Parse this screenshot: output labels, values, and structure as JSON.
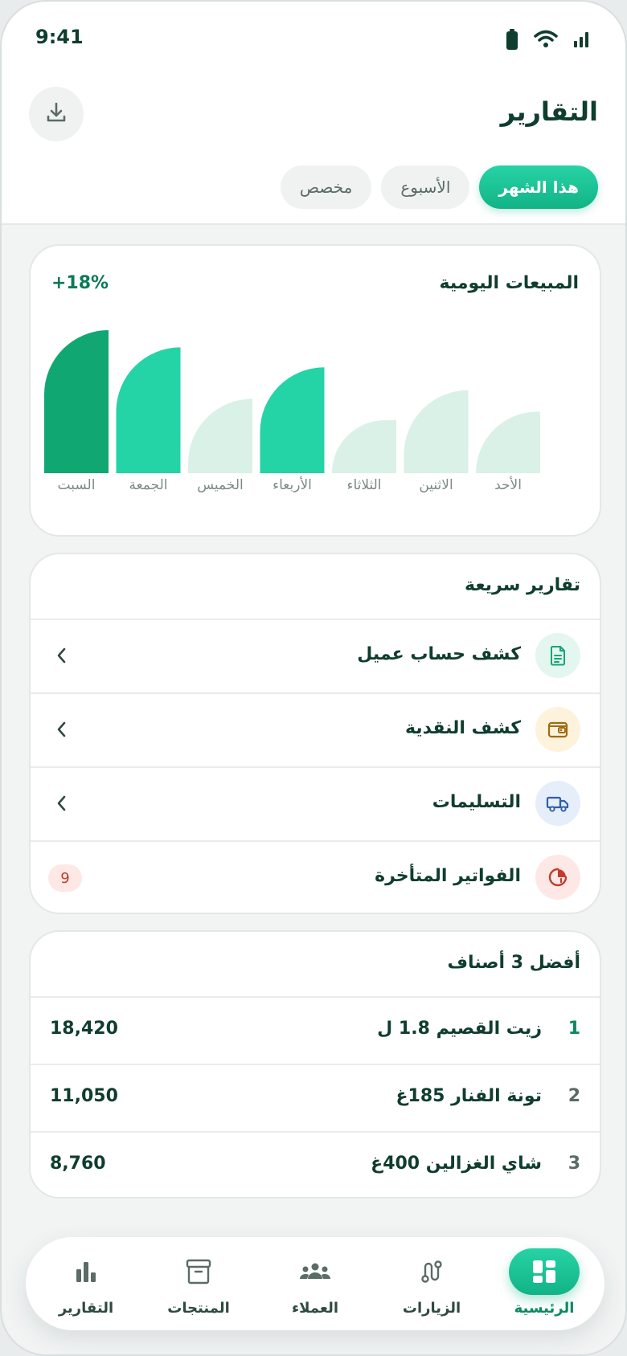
{
  "status_bar": {
    "time": "9:41"
  },
  "header": {
    "title": "التقارير",
    "download_icon": "download-icon"
  },
  "period_tabs": [
    {
      "label": "هذا الشهر",
      "active": true
    },
    {
      "label": "الأسبوع",
      "active": false
    },
    {
      "label": "مخصص",
      "active": false
    }
  ],
  "daily_sales": {
    "title": "المبيعات اليومية",
    "change": "+18%"
  },
  "chart_data": {
    "type": "bar",
    "title": "المبيعات اليومية",
    "categories": [
      "الأحد",
      "الاثنين",
      "الثلاثاء",
      "الأربعاء",
      "الخميس",
      "الجمعة",
      "السبت"
    ],
    "values": [
      43,
      58,
      37,
      74,
      52,
      88,
      100
    ],
    "levels": [
      "low",
      "low",
      "low",
      "high",
      "low",
      "high",
      "peak"
    ],
    "colors": {
      "low": "#d9f1e7",
      "high": "#24d3a6",
      "peak": "#10a772"
    },
    "ylim": [
      0,
      100
    ],
    "grid": false
  },
  "quick_reports": {
    "title": "تقارير سريعة",
    "items": [
      {
        "label": "كشف حساب عميل",
        "icon": "document-icon",
        "icon_bg": "#e3f6ef",
        "icon_color": "#10a772"
      },
      {
        "label": "كشف النقدية",
        "icon": "wallet-icon",
        "icon_bg": "#fdf2dc",
        "icon_color": "#a06a10"
      },
      {
        "label": "التسليمات",
        "icon": "truck-icon",
        "icon_bg": "#e6eefa",
        "icon_color": "#2e5fa8"
      },
      {
        "label": "الفواتير المتأخرة",
        "icon": "overdue-clock-icon",
        "icon_bg": "#fde8e6",
        "icon_color": "#c13a2c",
        "badge": "9"
      }
    ]
  },
  "top_products": {
    "title": "أفضل 3 أصناف",
    "rows": [
      {
        "rank": "1",
        "name": "زيت القصيم 1.8 ل",
        "amount": "18,420"
      },
      {
        "rank": "2",
        "name": "تونة الفنار 185غ",
        "amount": "11,050"
      },
      {
        "rank": "3",
        "name": "شاي الغزالين 400غ",
        "amount": "8,760"
      }
    ]
  },
  "bottom_nav": [
    {
      "label": "الرئيسية",
      "icon": "dashboard-icon",
      "active": true
    },
    {
      "label": "الزيارات",
      "icon": "route-icon",
      "active": false
    },
    {
      "label": "العملاء",
      "icon": "users-icon",
      "active": false
    },
    {
      "label": "المنتجات",
      "icon": "archive-box-icon",
      "active": false
    },
    {
      "label": "التقارير",
      "icon": "bar-chart-icon",
      "active": false
    }
  ]
}
